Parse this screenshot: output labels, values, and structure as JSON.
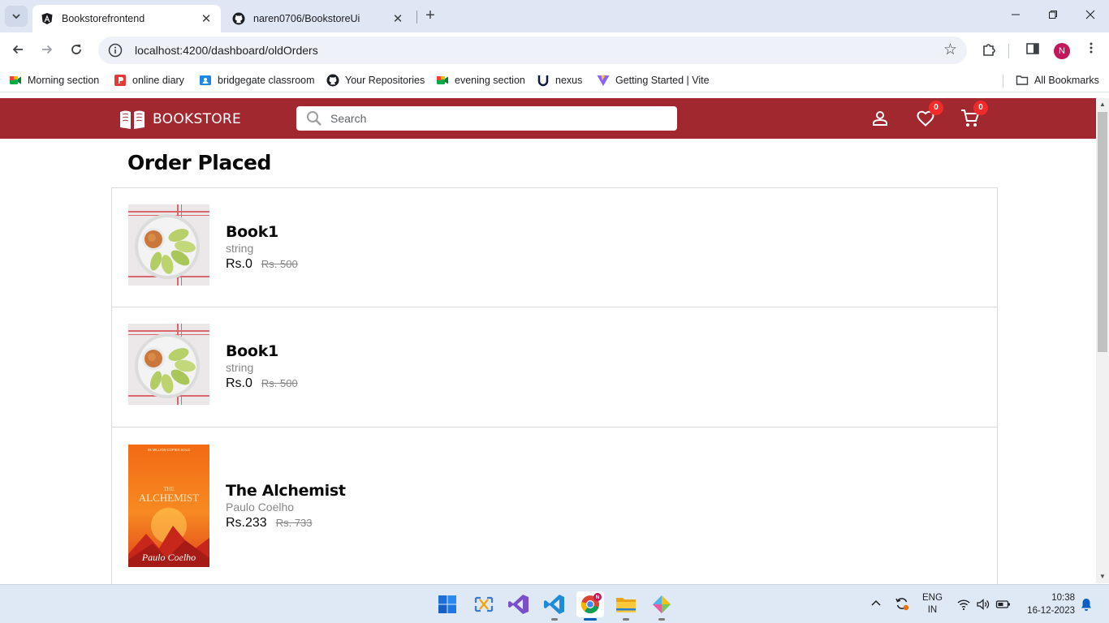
{
  "browser": {
    "tabs": [
      {
        "title": "Bookstorefrontend",
        "icon": "angular-icon",
        "active": true
      },
      {
        "title": "naren0706/BookstoreUi",
        "icon": "github-icon",
        "active": false
      }
    ],
    "url": "localhost:4200/dashboard/oldOrders",
    "profile_initial": "N",
    "bookmarks": [
      {
        "label": "Morning section",
        "icon": "google-meet-icon"
      },
      {
        "label": "online diary",
        "icon": "diary-icon"
      },
      {
        "label": "bridgegate classroom",
        "icon": "classroom-icon"
      },
      {
        "label": "Your Repositories",
        "icon": "github-icon"
      },
      {
        "label": "evening section",
        "icon": "google-meet-icon"
      },
      {
        "label": "nexus",
        "icon": "nexus-icon"
      },
      {
        "label": "Getting Started | Vite",
        "icon": "vite-icon"
      }
    ],
    "all_bookmarks_label": "All Bookmarks"
  },
  "app": {
    "brand": "BOOKSTORE",
    "search_placeholder": "Search",
    "wishlist_count": "0",
    "cart_count": "0",
    "header_color": "#a2282f",
    "page_title": "Order Placed",
    "orders": [
      {
        "name": "Book1",
        "author": "string",
        "price": "Rs.0",
        "mrp": "Rs. 500",
        "cover": "apple-plate-image"
      },
      {
        "name": "Book1",
        "author": "string",
        "price": "Rs.0",
        "mrp": "Rs. 500",
        "cover": "apple-plate-image"
      },
      {
        "name": "The Alchemist",
        "author": "Paulo Coelho",
        "price": "Rs.233",
        "mrp": "Rs. 733",
        "cover": "alchemist-cover-image"
      }
    ],
    "alchemist_cover": {
      "top": "55 MILLION COPIES SOLD",
      "title_small": "THE",
      "title": "ALCHEMIST",
      "author": "Paulo Coelho"
    }
  },
  "taskbar": {
    "apps": [
      "windows-start-icon",
      "snipping-tool-icon",
      "visual-studio-icon",
      "vscode-icon",
      "chrome-icon",
      "file-explorer-icon",
      "git-icon"
    ],
    "language": "ENG",
    "region": "IN",
    "time": "10:38",
    "date": "16-12-2023"
  }
}
